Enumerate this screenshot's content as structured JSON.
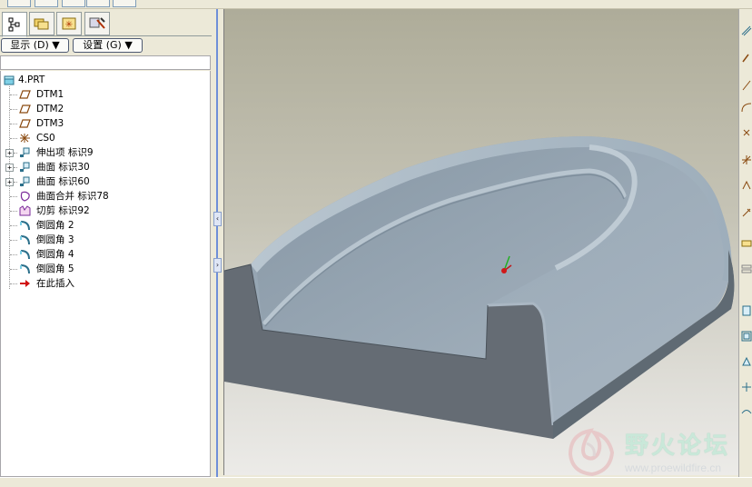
{
  "navigator": {
    "tabs": [
      {
        "icon": "model-tree-icon",
        "active": true
      },
      {
        "icon": "folder-browser-icon",
        "active": false
      },
      {
        "icon": "favorites-icon",
        "active": false
      },
      {
        "icon": "connections-icon",
        "active": false
      }
    ],
    "show_menu": "显示 (D) ▼",
    "settings_menu": "设置 (G) ▼"
  },
  "model_tree": {
    "root": "4.PRT",
    "items": [
      {
        "label": "DTM1",
        "icon": "datum-plane-icon",
        "expandable": false
      },
      {
        "label": "DTM2",
        "icon": "datum-plane-icon",
        "expandable": false
      },
      {
        "label": "DTM3",
        "icon": "datum-plane-icon",
        "expandable": false
      },
      {
        "label": "CS0",
        "icon": "coordinate-system-icon",
        "expandable": false
      },
      {
        "label": "伸出项 标识9",
        "icon": "protrusion-icon",
        "expandable": true
      },
      {
        "label": "曲面 标识30",
        "icon": "surface-icon",
        "expandable": true
      },
      {
        "label": "曲面 标识60",
        "icon": "surface-icon",
        "expandable": true
      },
      {
        "label": "曲面合并 标识78",
        "icon": "surface-merge-icon",
        "expandable": false
      },
      {
        "label": "切剪 标识92",
        "icon": "cut-icon",
        "expandable": false
      },
      {
        "label": "倒圆角 2",
        "icon": "round-icon",
        "expandable": false
      },
      {
        "label": "倒圆角 3",
        "icon": "round-icon",
        "expandable": false
      },
      {
        "label": "倒圆角 4",
        "icon": "round-icon",
        "expandable": false
      },
      {
        "label": "倒圆角 5",
        "icon": "round-icon",
        "expandable": false
      },
      {
        "label": "在此插入",
        "icon": "insert-here-arrow-icon",
        "expandable": false
      }
    ]
  },
  "splitter": {
    "collapse_arrow": "‹",
    "expand_arrow": "›"
  },
  "watermark": {
    "title": "野火论坛",
    "url": "www.proewildfire.cn"
  },
  "colors": {
    "part_face": "#97a6b3",
    "part_side": "#646c75",
    "selection_blue": "#6f8fd8"
  }
}
